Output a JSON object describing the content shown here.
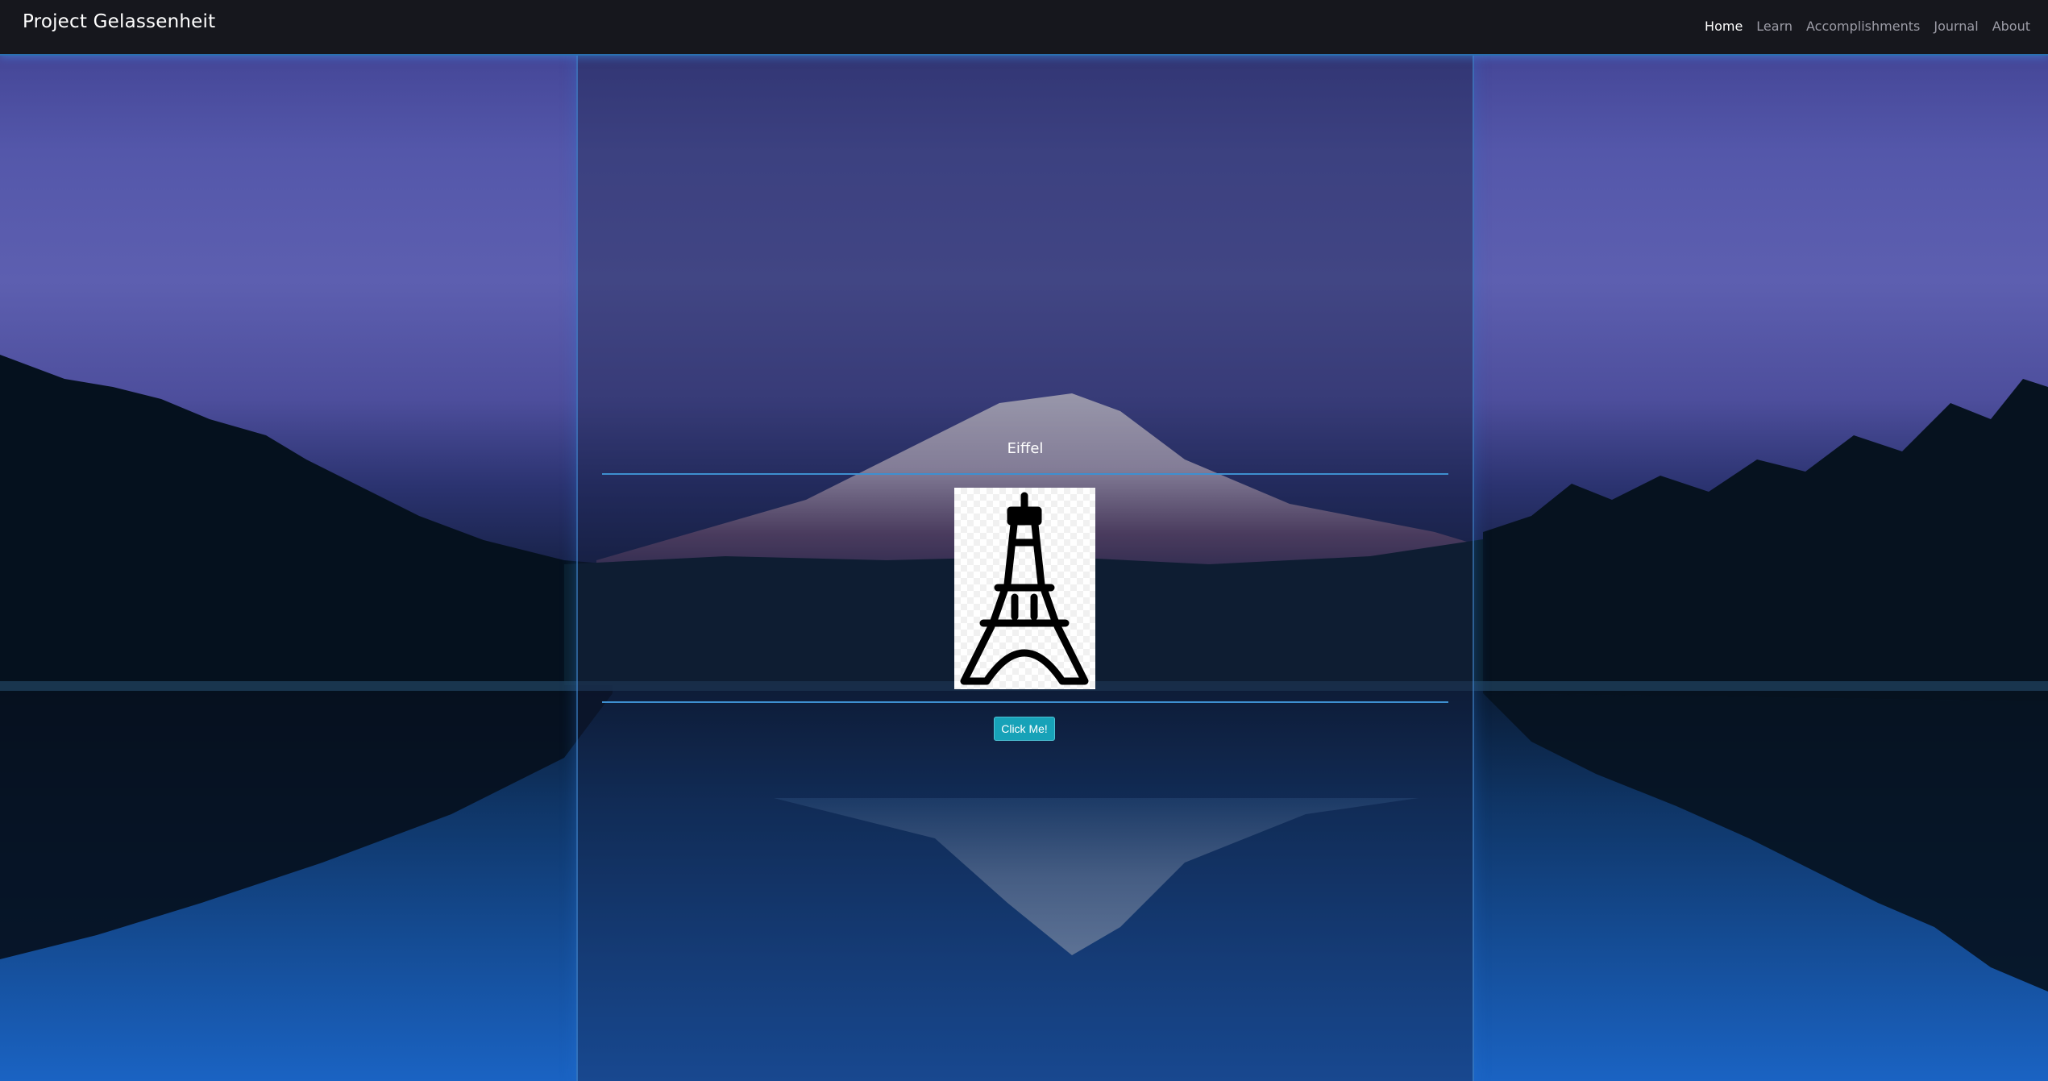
{
  "navbar": {
    "brand": "Project Gelassenheit",
    "links": [
      {
        "label": "Home",
        "active": true
      },
      {
        "label": "Learn",
        "active": false
      },
      {
        "label": "Accomplishments",
        "active": false
      },
      {
        "label": "Journal",
        "active": false
      },
      {
        "label": "About",
        "active": false
      }
    ]
  },
  "card": {
    "title": "Eiffel",
    "image_icon": "eiffel-tower-icon",
    "button_label": "Click Me!"
  },
  "colors": {
    "navbar_bg": "#16171d",
    "accent_line": "#3e8fd0",
    "button_bg": "#17a2b8"
  },
  "background": "mountain-lake-night"
}
